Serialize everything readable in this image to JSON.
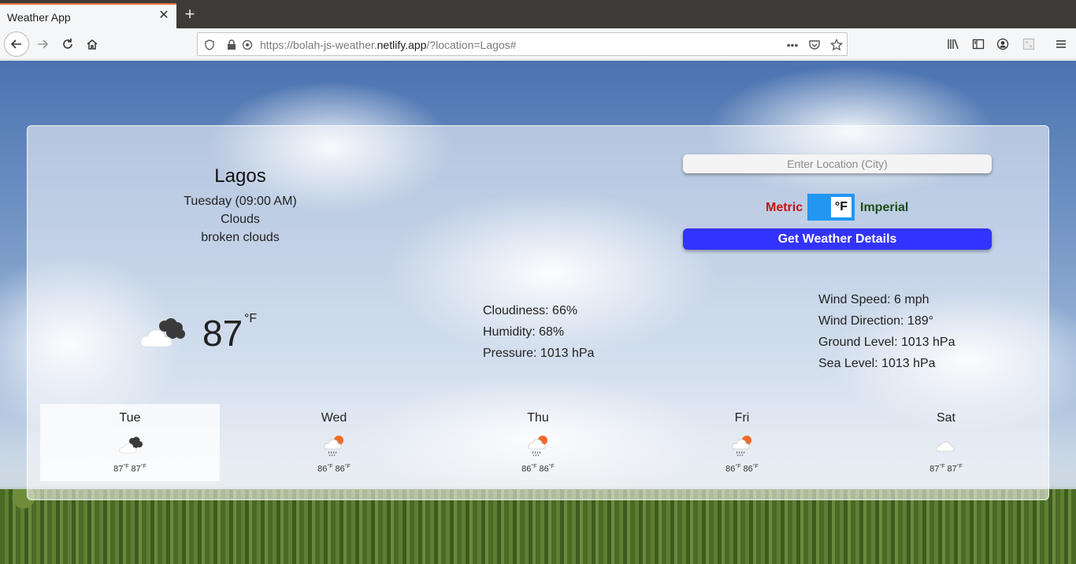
{
  "browser": {
    "tab_title": "Weather App",
    "url_prefix": "https://bolah-js-weather.",
    "url_host": "netlify.app",
    "url_suffix": "/?location=Lagos#"
  },
  "current": {
    "city": "Lagos",
    "datetime": "Tuesday (09:00 AM)",
    "condition": "Clouds",
    "description": "broken clouds",
    "temperature": "87",
    "unit": "°F",
    "icon": "broken-clouds-icon"
  },
  "stats_middle": [
    "Cloudiness: 66%",
    "Humidity: 68%",
    "Pressure: 1013 hPa"
  ],
  "stats_right": [
    "Wind Speed: 6 mph",
    "Wind Direction: 189°",
    "Ground Level: 1013 hPa",
    "Sea Level: 1013 hPa"
  ],
  "controls": {
    "location_placeholder": "Enter Location (City)",
    "metric_label": "Metric",
    "imperial_label": "Imperial",
    "toggle_text": "°F",
    "toggle_state": "imperial",
    "button_label": "Get Weather Details"
  },
  "forecast": [
    {
      "day": "Tue",
      "max": "87",
      "min": "87",
      "unit": "°F",
      "icon": "broken-clouds-icon",
      "active": true
    },
    {
      "day": "Wed",
      "max": "86",
      "min": "86",
      "unit": "°F",
      "icon": "rain-sun-icon",
      "active": false
    },
    {
      "day": "Thu",
      "max": "86",
      "min": "86",
      "unit": "°F",
      "icon": "rain-sun-icon",
      "active": false
    },
    {
      "day": "Fri",
      "max": "86",
      "min": "86",
      "unit": "°F",
      "icon": "rain-sun-icon",
      "active": false
    },
    {
      "day": "Sat",
      "max": "87",
      "min": "87",
      "unit": "°F",
      "icon": "cloud-icon",
      "active": false
    }
  ],
  "colors": {
    "metric": "#cc1111",
    "imperial": "#1a4d1a",
    "button": "#3333ff",
    "toggle": "#2196f3",
    "tab_accent": "#ff7139"
  }
}
